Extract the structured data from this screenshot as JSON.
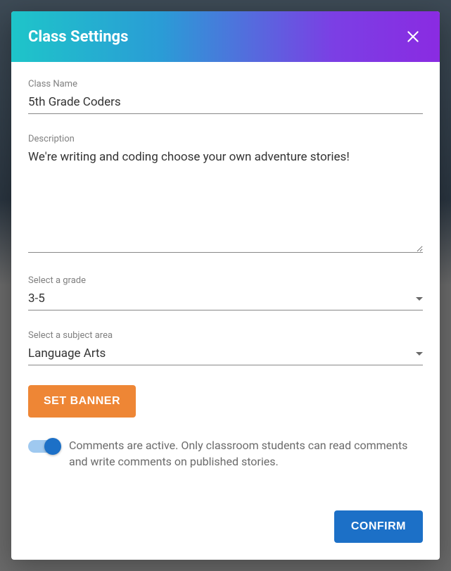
{
  "modal": {
    "title": "Class Settings",
    "fields": {
      "class_name": {
        "label": "Class Name",
        "value": "5th Grade Coders"
      },
      "description": {
        "label": "Description",
        "value": "We're writing and coding choose your own adventure stories!"
      },
      "grade": {
        "label": "Select a grade",
        "value": "3-5"
      },
      "subject": {
        "label": "Select a subject area",
        "value": "Language Arts"
      }
    },
    "set_banner_label": "SET BANNER",
    "comments_toggle": {
      "active": true,
      "text": "Comments are active. Only classroom students can read comments and write comments on published stories."
    },
    "confirm_label": "CONFIRM"
  }
}
